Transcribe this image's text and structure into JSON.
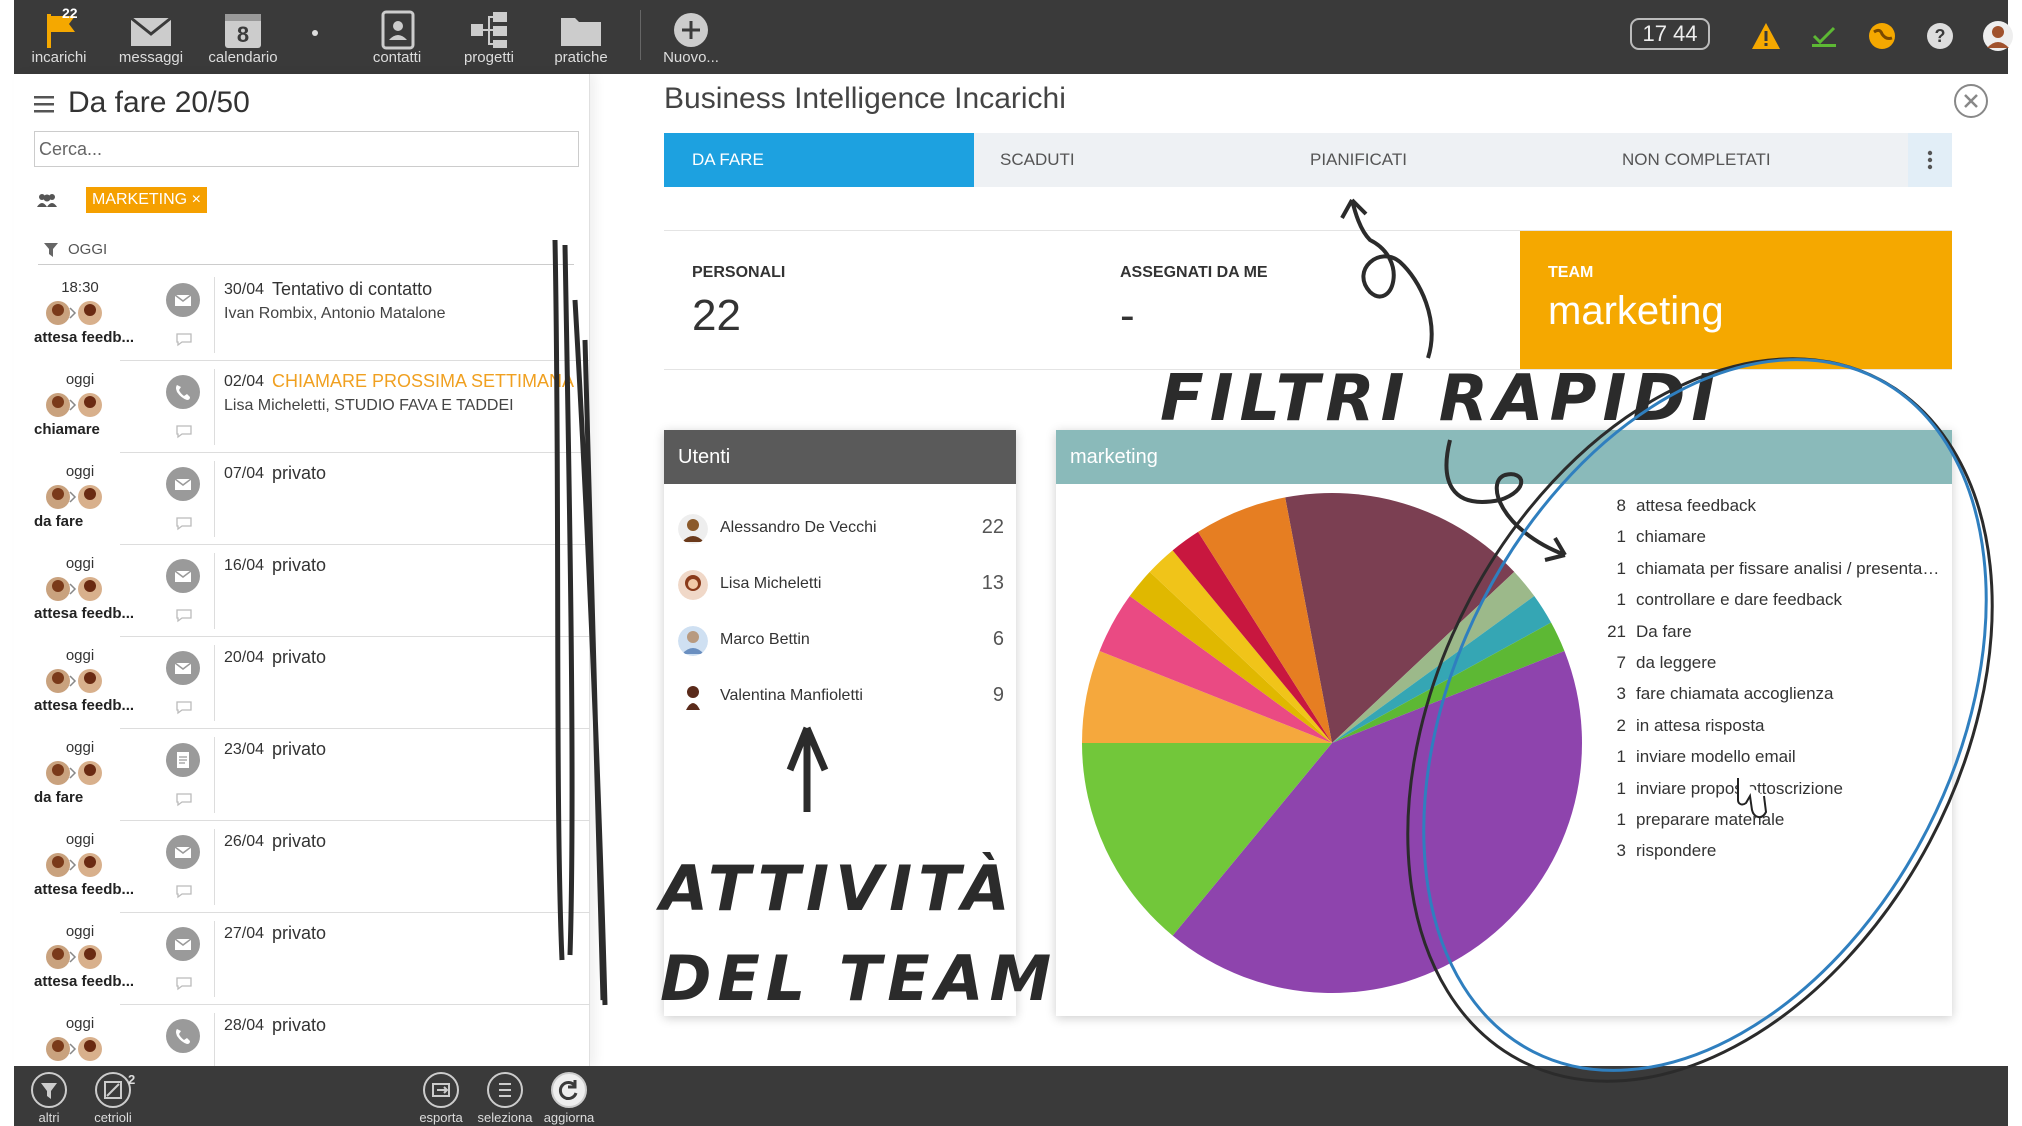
{
  "topbar": {
    "items": [
      {
        "label": "incarichi",
        "badge": "22",
        "icon": "flag-icon"
      },
      {
        "label": "messaggi",
        "icon": "envelope-icon"
      },
      {
        "label": "calendario",
        "day": "8",
        "icon": "calendar-icon"
      },
      {
        "label": "contatti",
        "icon": "contacts-icon"
      },
      {
        "label": "progetti",
        "icon": "projects-icon"
      },
      {
        "label": "pratiche",
        "icon": "folder-icon"
      },
      {
        "label": "Nuovo...",
        "icon": "plus-icon"
      }
    ],
    "clock": "17 44",
    "colors": {
      "bar": "#3a3a3a",
      "warning": "#f5a800",
      "accent": "#1da1e0"
    }
  },
  "left": {
    "header": "Da fare 20/50",
    "search_placeholder": "Cerca...",
    "tag": "MARKETING ×",
    "group_label": "OGGI",
    "tasks": [
      {
        "time": "18:30",
        "status": "attesa feedb...",
        "date": "30/04",
        "title": "Tentativo di contatto",
        "sub": "Ivan Rombix, Antonio Matalone",
        "icon": "envelope-icon",
        "highlight": false
      },
      {
        "time": "oggi",
        "status": "chiamare",
        "date": "02/04",
        "title": "CHIAMARE PROSSIMA SETTIMANA",
        "sub": "Lisa Micheletti, STUDIO FAVA E TADDEI",
        "icon": "phone-icon",
        "highlight": true
      },
      {
        "time": "oggi",
        "status": "da fare",
        "date": "07/04",
        "title": "privato",
        "sub": "",
        "icon": "envelope-icon",
        "highlight": false
      },
      {
        "time": "oggi",
        "status": "attesa feedb...",
        "date": "16/04",
        "title": "privato",
        "sub": "",
        "icon": "envelope-icon",
        "highlight": false
      },
      {
        "time": "oggi",
        "status": "attesa feedb...",
        "date": "20/04",
        "title": "privato",
        "sub": "",
        "icon": "envelope-icon",
        "highlight": false
      },
      {
        "time": "oggi",
        "status": "da fare",
        "date": "23/04",
        "title": "privato",
        "sub": "",
        "icon": "document-icon",
        "highlight": false
      },
      {
        "time": "oggi",
        "status": "attesa feedb...",
        "date": "26/04",
        "title": "privato",
        "sub": "",
        "icon": "envelope-icon",
        "highlight": false
      },
      {
        "time": "oggi",
        "status": "attesa feedb...",
        "date": "27/04",
        "title": "privato",
        "sub": "",
        "icon": "envelope-icon",
        "highlight": false
      },
      {
        "time": "oggi",
        "status": "",
        "date": "28/04",
        "title": "privato",
        "sub": "",
        "icon": "phone-icon",
        "highlight": false
      }
    ]
  },
  "main": {
    "title": "Business Intelligence Incarichi",
    "tabs": [
      "DA FARE",
      "SCADUTI",
      "PIANIFICATI",
      "NON COMPLETATI"
    ],
    "cards": {
      "personali_label": "PERSONALI",
      "personali_value": "22",
      "assegnati_label": "ASSEGNATI DA ME",
      "assegnati_value": "-",
      "team_label": "TEAM",
      "team_value": "marketing"
    },
    "users_title": "Utenti",
    "users": [
      {
        "name": "Alessandro De Vecchi",
        "count": "22"
      },
      {
        "name": "Lisa Micheletti",
        "count": "13"
      },
      {
        "name": "Marco Bettin",
        "count": "6"
      },
      {
        "name": "Valentina Manfioletti",
        "count": "9"
      }
    ],
    "chart_title": "marketing"
  },
  "chart_data": {
    "type": "pie",
    "title": "marketing",
    "slices": [
      {
        "label": "attesa feedback",
        "value": 8,
        "color": "#7b3f52"
      },
      {
        "label": "chiamare",
        "value": 1,
        "color": "#9cb98a"
      },
      {
        "label": "chiamata per fissare analisi / presentazi...",
        "value": 1,
        "color": "#35a6b4"
      },
      {
        "label": "controllare e dare feedback",
        "value": 1,
        "color": "#5db834"
      },
      {
        "label": "Da fare",
        "value": 21,
        "color": "#8e44ad"
      },
      {
        "label": "da leggere",
        "value": 7,
        "color": "#72c73a"
      },
      {
        "label": "fare chiamata accoglienza",
        "value": 3,
        "color": "#f5a83d"
      },
      {
        "label": "in attesa risposta",
        "value": 2,
        "color": "#ea4a83"
      },
      {
        "label": "inviare modello email",
        "value": 1,
        "color": "#e0b800"
      },
      {
        "label": "inviare proposta sottoscrizione",
        "value": 1,
        "color": "#f0c419"
      },
      {
        "label": "preparare materiale",
        "value": 1,
        "color": "#c8173f"
      },
      {
        "label": "rispondere",
        "value": 3,
        "color": "#e67e22"
      }
    ],
    "legend_labels": [
      "attesa feedback",
      "chiamare",
      "chiamata per fissare analisi / presentazi...",
      "controllare e dare feedback",
      "Da fare",
      "da leggere",
      "fare chiamata accoglienza",
      "in attesa risposta",
      "inviare modello email",
      "inviare propos  ottoscrizione",
      "preparare materiale",
      "rispondere"
    ],
    "legend_placement": "right"
  },
  "annotations": {
    "filtri": "FILTRI RAPIDI",
    "attivita_line1": "ATTIVITÀ",
    "attivita_line2": "DEL TEAM"
  },
  "bottombar": {
    "left": [
      {
        "label": "altri",
        "icon": "filter-icon"
      },
      {
        "label": "cetrioli",
        "badge": "2",
        "icon": "board-icon"
      }
    ],
    "center": [
      {
        "label": "esporta",
        "icon": "export-icon"
      },
      {
        "label": "seleziona",
        "icon": "list-icon"
      },
      {
        "label": "aggiorna",
        "icon": "refresh-icon"
      }
    ]
  }
}
